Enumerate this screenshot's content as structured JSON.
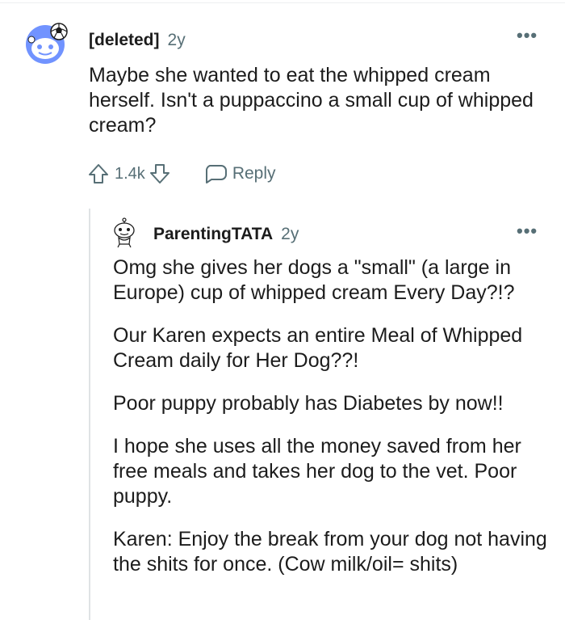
{
  "comment": {
    "author": "[deleted]",
    "time": "2y",
    "more_label": "•••",
    "body": "Maybe she wanted to eat the whipped cream herself. Isn't a puppaccino a small cup of whipped cream?",
    "votes": "1.4k",
    "reply_label": "Reply",
    "icons": [
      "reddit-snoo-avatar-icon",
      "upvote-icon",
      "downvote-icon",
      "reply-bubble-icon",
      "more-options-icon"
    ]
  },
  "reply": {
    "author": "ParentingTATA",
    "time": "2y",
    "more_label": "•••",
    "paragraphs": [
      "Omg she gives her dogs a \"small\" (a large in Europe) cup of whipped cream Every Day?!?",
      "Our Karen expects an entire Meal of Whipped Cream daily for Her Dog??!",
      "Poor puppy probably has Diabetes by now!!",
      "I hope she uses all the money saved from her free meals and takes her dog to the vet. Poor puppy.",
      "Karen: Enjoy the break from your dog not having the shits for once. (Cow milk/oil= shits)"
    ]
  },
  "colors": {
    "text": "#1c1c1c",
    "meta": "#576f76",
    "avatar_blue": "#7193ff",
    "thread_line": "#dfe3e5"
  }
}
